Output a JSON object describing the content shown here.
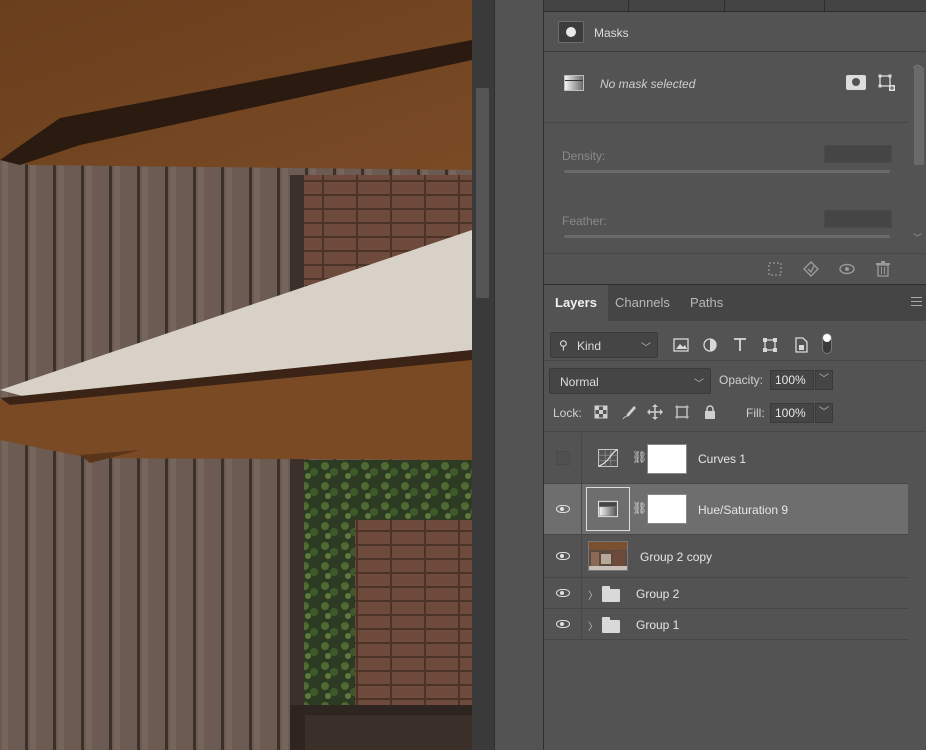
{
  "masks_panel": {
    "title": "Masks",
    "no_mask_text": "No mask selected",
    "density_label": "Density:",
    "feather_label": "Feather:"
  },
  "layers_panel": {
    "tabs": [
      {
        "label": "Layers",
        "active": true
      },
      {
        "label": "Channels",
        "active": false
      },
      {
        "label": "Paths",
        "active": false
      }
    ],
    "filter_kind": "Kind",
    "blend_mode": "Normal",
    "opacity_label": "Opacity:",
    "opacity_value": "100%",
    "lock_label": "Lock:",
    "fill_label": "Fill:",
    "fill_value": "100%",
    "layers": [
      {
        "name": "Curves 1",
        "visible": false,
        "type": "curves-adjustment",
        "selected": false
      },
      {
        "name": "Hue/Saturation 9",
        "visible": true,
        "type": "hue-saturation-adjustment",
        "selected": true
      },
      {
        "name": "Group 2 copy",
        "visible": true,
        "type": "pixel-layer",
        "selected": false
      },
      {
        "name": "Group 2",
        "visible": true,
        "type": "group",
        "selected": false
      },
      {
        "name": "Group 1",
        "visible": true,
        "type": "group",
        "selected": false
      }
    ]
  },
  "icons": {
    "masks_panel": "layer-mask-icon",
    "gradient": "hue-saturation-icon",
    "pixel_mask": "add-pixel-mask-icon",
    "vector_mask": "add-vector-mask-icon",
    "load_selection": "load-selection-icon",
    "apply_mask": "apply-mask-icon",
    "toggle_mask": "eye-icon",
    "delete_mask": "trash-icon"
  },
  "colors": {
    "panel_bg": "#535353",
    "selected_layer_bg": "#6e6e6e",
    "tab_bar_bg": "#454545"
  }
}
